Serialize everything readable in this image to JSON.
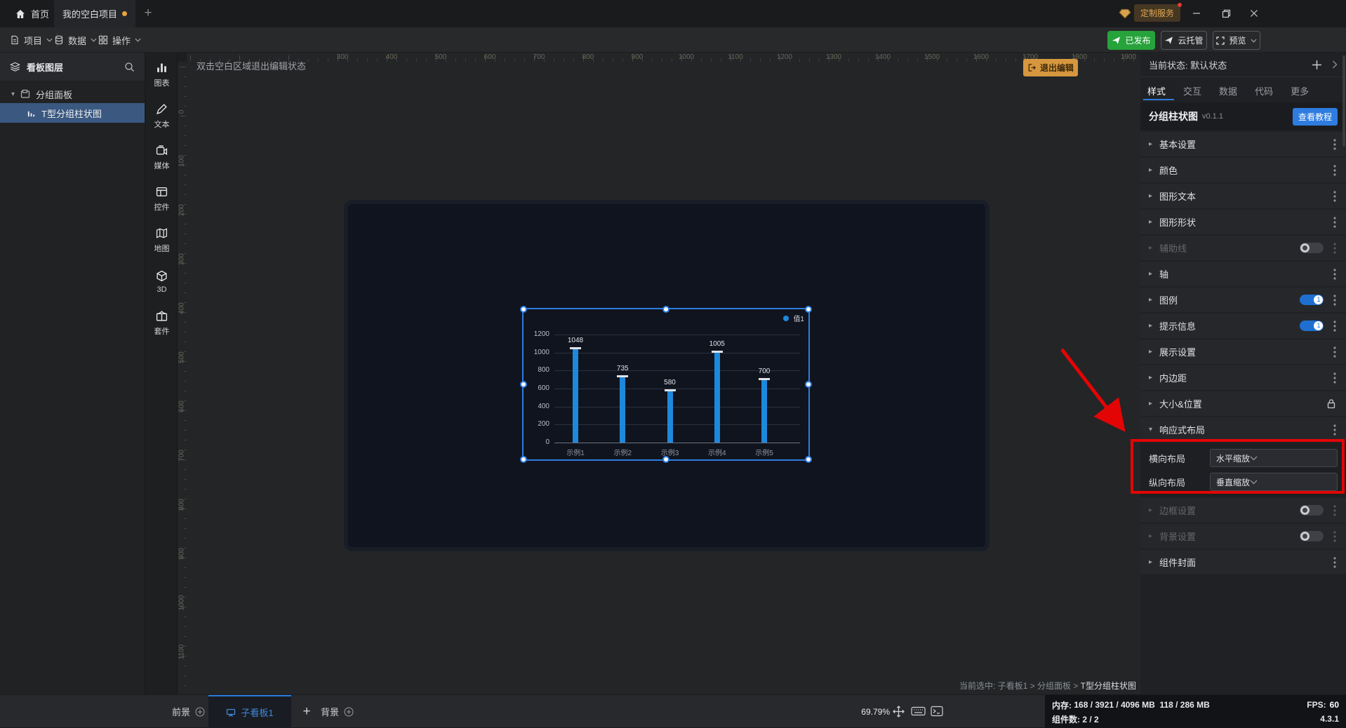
{
  "colors": {
    "accent": "#2e7ce0",
    "bar_blue": "#1e88dc",
    "green": "#27a33c",
    "orange_btn": "#d7973f",
    "annotation_red": "#e30505",
    "selected_row": "#3a5880"
  },
  "titlebar": {
    "home_label": "首页",
    "project_tab": "我的空白项目",
    "add_tab": "+",
    "custom_service": "定制服务",
    "window_controls": {
      "minimize": "minimize-icon",
      "maximize": "maximize-icon",
      "close": "close-icon"
    }
  },
  "menubar": {
    "items": [
      {
        "icon": "doc",
        "label": "项目"
      },
      {
        "icon": "db",
        "label": "数据"
      },
      {
        "icon": "gridop",
        "label": "操作"
      }
    ],
    "published_label": "已发布",
    "cloud_label": "云托管",
    "preview_label": "预览"
  },
  "left_panel": {
    "header": "看板图层",
    "group_item": "分组面板",
    "selected_item": "T型分组柱状图"
  },
  "toolbox": [
    {
      "icon": "chart",
      "label": "图表"
    },
    {
      "icon": "text",
      "label": "文本"
    },
    {
      "icon": "media",
      "label": "媒体"
    },
    {
      "icon": "widget",
      "label": "控件"
    },
    {
      "icon": "map",
      "label": "地图"
    },
    {
      "icon": "cube",
      "label": "3D"
    },
    {
      "icon": "kit",
      "label": "套件"
    }
  ],
  "canvas": {
    "hint": "双击空白区域退出编辑状态",
    "exit_edit": "退出编辑",
    "ruler_h": [
      300,
      400,
      500,
      600,
      700,
      800,
      900,
      1000,
      1100,
      1200,
      1300,
      1400,
      1500,
      1600,
      1700,
      1800,
      1900
    ],
    "ruler_v": [
      0,
      100,
      200,
      300,
      400,
      500,
      600,
      700,
      800,
      900,
      1000,
      1100
    ],
    "breadcrumb_prefix": "当前选中: 子看板1 > 分组面板 > ",
    "breadcrumb_current": "T型分组柱状图"
  },
  "chart_data": {
    "type": "bar",
    "title": "",
    "categories": [
      "示例1",
      "示例2",
      "示例3",
      "示例4",
      "示例5"
    ],
    "series": [
      {
        "name": "值1",
        "values": [
          1048,
          735,
          580,
          1005,
          700
        ]
      }
    ],
    "yticks": [
      0,
      200,
      400,
      600,
      800,
      1000,
      1200
    ],
    "ylim": [
      0,
      1200
    ],
    "legend_position": "top-right",
    "grid": true,
    "bar_style": "T-cap"
  },
  "right_panel": {
    "state_label": "当前状态: 默认状态",
    "tabs": [
      "样式",
      "交互",
      "数据",
      "代码",
      "更多"
    ],
    "active_tab": "样式",
    "component_name": "分组柱状图",
    "component_version": "v0.1.1",
    "tutorial_button": "查看教程",
    "sections": [
      {
        "label": "基本设置",
        "caret": "r",
        "trail": "kebab"
      },
      {
        "label": "颜色",
        "caret": "r",
        "trail": "kebab"
      },
      {
        "label": "图形文本",
        "caret": "r",
        "trail": "kebab"
      },
      {
        "label": "图形形状",
        "caret": "r",
        "trail": "kebab"
      },
      {
        "label": "辅助线",
        "caret": "r",
        "toggle": "off",
        "trail": "kebab",
        "disabled": true
      },
      {
        "label": "轴",
        "caret": "r",
        "trail": "kebab"
      },
      {
        "label": "图例",
        "caret": "r",
        "toggle": "on",
        "trail": "kebab"
      },
      {
        "label": "提示信息",
        "caret": "r",
        "toggle": "on",
        "trail": "kebab"
      },
      {
        "label": "展示设置",
        "caret": "r",
        "trail": "kebab"
      },
      {
        "label": "内边距",
        "caret": "r",
        "trail": "kebab"
      },
      {
        "label": "大小&位置",
        "caret": "r",
        "trail": "lock"
      },
      {
        "label": "响应式布局",
        "caret": "d",
        "trail": "kebab",
        "expanded": true
      },
      {
        "label": "边框设置",
        "caret": "r",
        "toggle": "off",
        "trail": "kebab",
        "disabled": true
      },
      {
        "label": "背景设置",
        "caret": "r",
        "toggle": "off",
        "trail": "kebab",
        "disabled": true
      },
      {
        "label": "组件封面",
        "caret": "r",
        "trail": "kebab"
      }
    ],
    "fields": [
      {
        "label": "横向布局",
        "value": "水平缩放"
      },
      {
        "label": "纵向布局",
        "value": "垂直缩放"
      }
    ]
  },
  "bottombar": {
    "foreground": "前景",
    "active_board": "子看板1",
    "add": "+",
    "background": "背景",
    "zoom": "69.79%",
    "memory_label": "内存:",
    "memory_value": "168 / 3921 / 4096 MB",
    "memory_value2": "118 / 286 MB",
    "fps_label": "FPS:",
    "fps_value": "60",
    "components_label": "组件数: 2 / 2",
    "version": "4.3.1"
  }
}
